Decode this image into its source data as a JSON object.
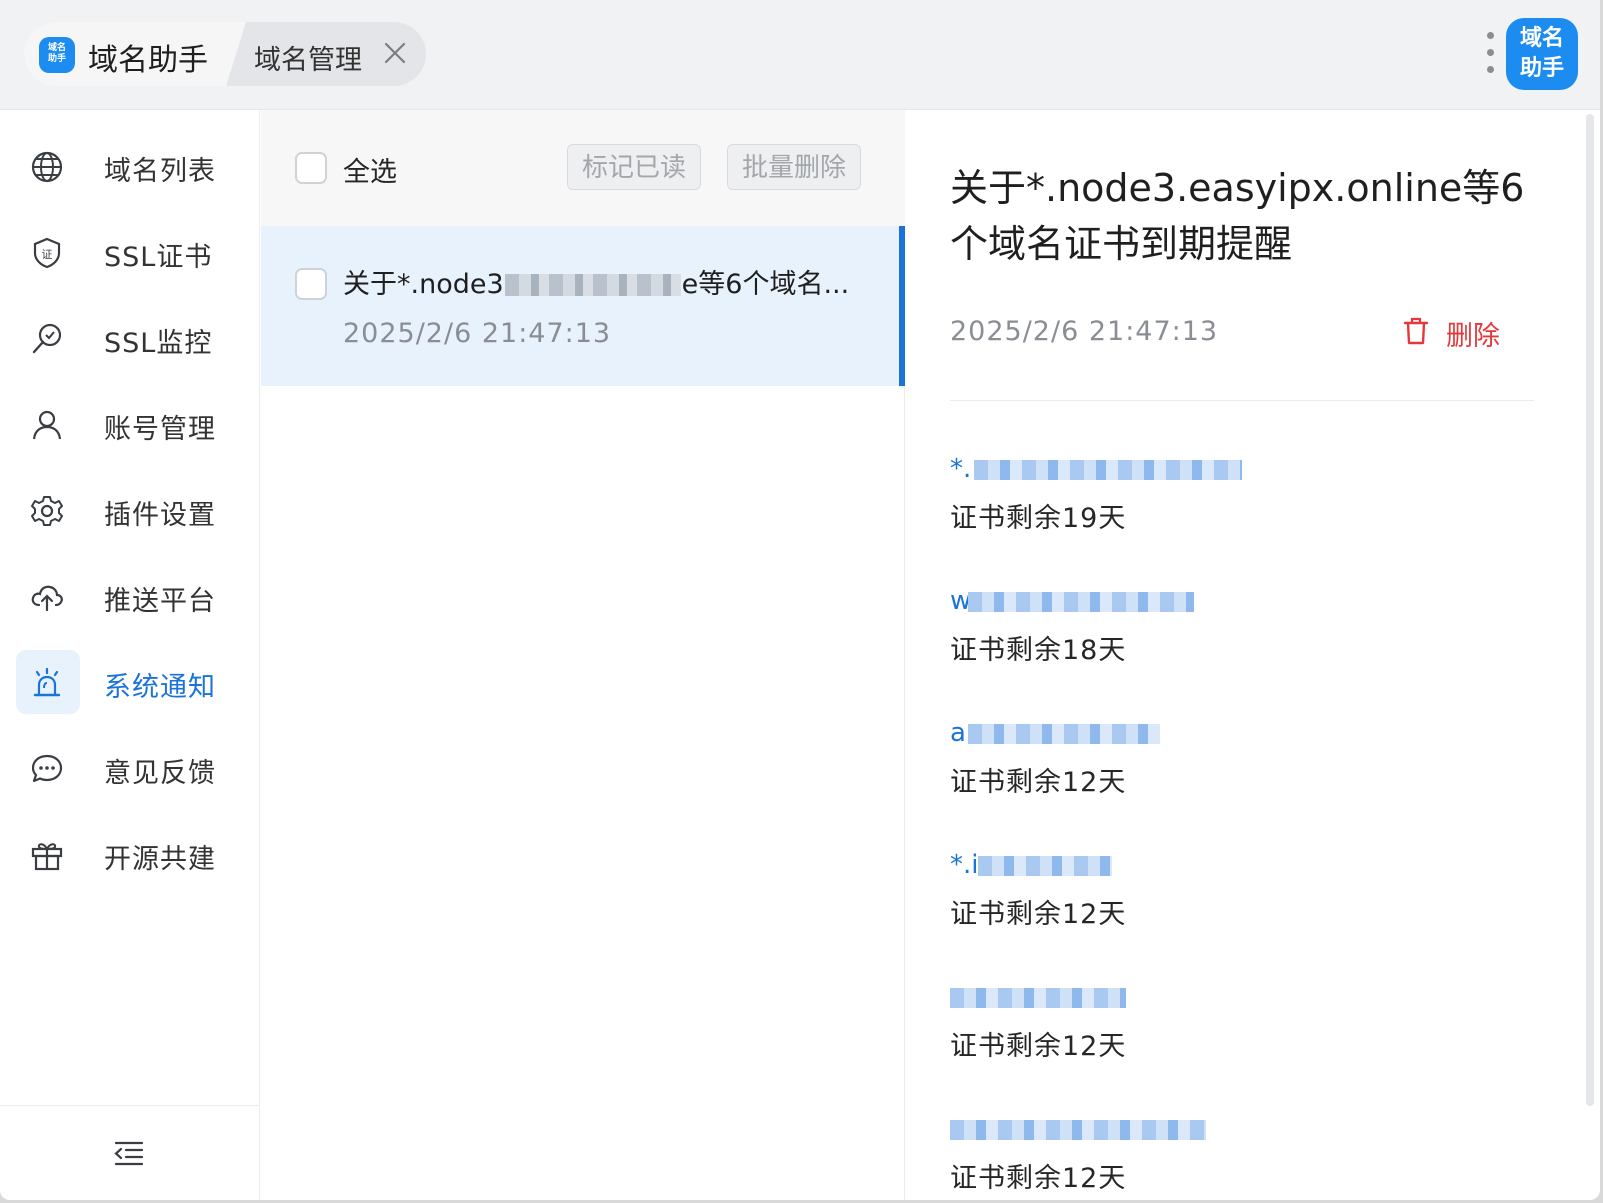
{
  "header": {
    "app_logo_text": "域名助手",
    "home_tab": "域名助手",
    "second_tab": "域名管理",
    "badge_text": "域名助手"
  },
  "sidebar": {
    "items": [
      {
        "label": "域名列表",
        "icon": "globe-icon"
      },
      {
        "label": "SSL证书",
        "icon": "certificate-shield-icon"
      },
      {
        "label": "SSL监控",
        "icon": "monitor-search-icon"
      },
      {
        "label": "账号管理",
        "icon": "user-icon"
      },
      {
        "label": "插件设置",
        "icon": "gear-icon"
      },
      {
        "label": "推送平台",
        "icon": "cloud-upload-icon"
      },
      {
        "label": "系统通知",
        "icon": "alarm-icon",
        "active": true
      },
      {
        "label": "意见反馈",
        "icon": "chat-bubble-icon"
      },
      {
        "label": "开源共建",
        "icon": "gift-icon"
      }
    ],
    "collapse_icon": "menu-fold-icon"
  },
  "list": {
    "select_all": "全选",
    "mark_read": "标记已读",
    "batch_delete": "批量删除",
    "items": [
      {
        "title_prefix": "关于*.node3",
        "title_suffix": "e等6个域名...",
        "time": "2025/2/6 21:47:13"
      }
    ]
  },
  "detail": {
    "title": "关于*.node3.easyipx.online等6个域名证书到期提醒",
    "time": "2025/2/6 21:47:13",
    "delete": "删除",
    "domains": [
      {
        "prefix": "*.",
        "remaining": "证书剩余19天"
      },
      {
        "prefix": "w",
        "remaining": "证书剩余18天"
      },
      {
        "prefix": "a",
        "remaining": "证书剩余12天"
      },
      {
        "prefix": "*.i",
        "remaining": "证书剩余12天"
      },
      {
        "prefix": "",
        "remaining": "证书剩余12天"
      },
      {
        "prefix": "",
        "remaining": "证书剩余12天"
      }
    ]
  },
  "colors": {
    "accent": "#1a73d9",
    "brand": "#1c8cf0",
    "danger": "#e5383b",
    "selected_bg": "#e8f2fc"
  }
}
